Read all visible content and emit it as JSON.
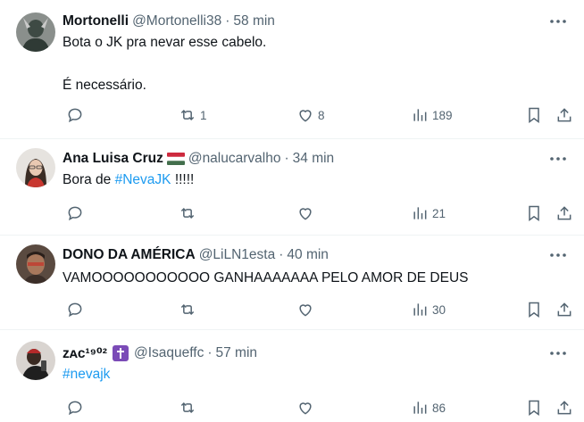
{
  "tweets": [
    {
      "name": "Mortonelli",
      "handle": "@Mortonelli38",
      "time": "58 min",
      "text1": "Bota o JK pra nevar esse cabelo.",
      "text2": "É necessário.",
      "retweets": "1",
      "likes": "8",
      "views": "189"
    },
    {
      "name": "Ana Luisa Cruz",
      "handle": "@nalucarvalho",
      "time": "34 min",
      "text_prefix": "Bora de ",
      "hashtag": "#NevaJK",
      "text_suffix": " !!!!!",
      "retweets": "",
      "likes": "",
      "views": "21"
    },
    {
      "name": "DONO DA AMÉRICA",
      "handle": "@LiLN1esta",
      "time": "40 min",
      "text1": "VAMOOOOOOOOOOO GANHAAAAAAA PELO AMOR DE DEUS",
      "retweets": "",
      "likes": "",
      "views": "30"
    },
    {
      "name": "ᴢᴀᴄ¹⁹⁰²",
      "handle": "@Isaqueffc",
      "time": "57 min",
      "hashtag": "#nevajk",
      "retweets": "",
      "likes": "",
      "views": "86"
    }
  ],
  "separator": "·",
  "colors": {
    "accent": "#1d9bf0",
    "muted": "#536471",
    "text": "#0f1419",
    "badge": "#7b4bb7"
  },
  "icons": [
    "reply-icon",
    "retweet-icon",
    "like-icon",
    "views-icon",
    "bookmark-icon",
    "share-icon",
    "more-icon",
    "hungary-flag-icon",
    "cross-badge-icon"
  ]
}
